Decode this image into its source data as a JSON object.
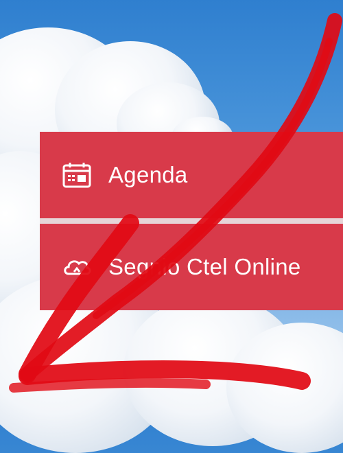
{
  "menu": {
    "items": [
      {
        "label": "Agenda",
        "icon": "calendar-icon"
      },
      {
        "label": "Segnio Ctel Online",
        "icon": "cloud-sync-icon"
      }
    ]
  },
  "colors": {
    "menu_bg": "#d83a4a",
    "arrow": "#e10a14",
    "sky": "#2f7fcf"
  }
}
